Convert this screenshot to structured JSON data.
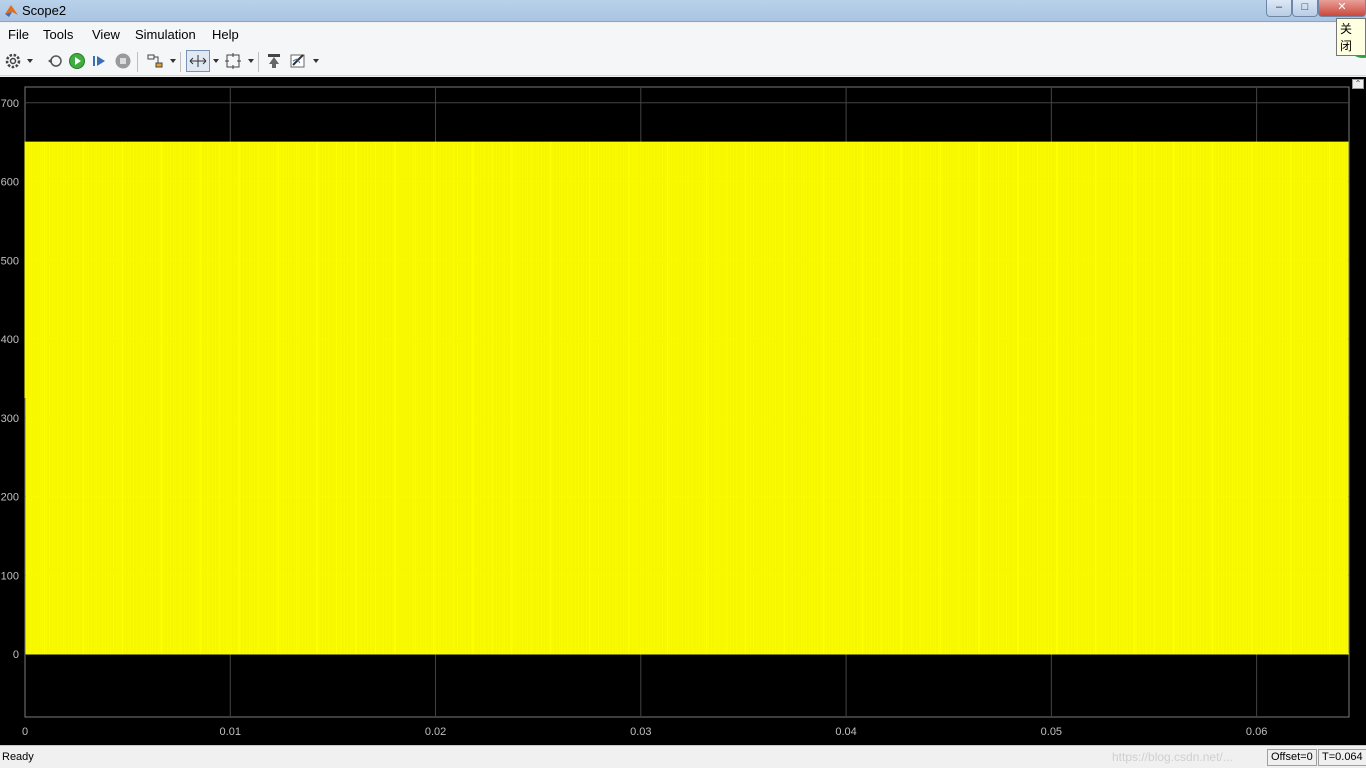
{
  "window": {
    "title": "Scope2",
    "close_tooltip": "关闭",
    "minimize": "‒",
    "maximize": "□",
    "close": "✕"
  },
  "menu": {
    "items": [
      "File",
      "Tools",
      "View",
      "Simulation",
      "Help"
    ]
  },
  "toolbar": {
    "icons": [
      "parameters-gear-icon",
      "restore-icon",
      "run-icon",
      "step-forward-icon",
      "stop-icon",
      "signal-selector-icon",
      "zoom-x-icon",
      "autoscale-icon",
      "highlight-block-icon",
      "style-icon"
    ]
  },
  "colors": {
    "plot_bg": "#000000",
    "signal": "#ffff00",
    "grid": "#444444",
    "axis_text": "#c0c0c0"
  },
  "chart_data": {
    "type": "line",
    "title": "",
    "xlabel": "",
    "ylabel": "",
    "xlim": [
      0,
      0.0645
    ],
    "ylim": [
      -80,
      720
    ],
    "xticks": [
      0,
      0.01,
      0.02,
      0.03,
      0.04,
      0.05,
      0.06
    ],
    "xtick_labels": [
      "0",
      "0.01",
      "0.02",
      "0.03",
      "0.04",
      "0.05",
      "0.06"
    ],
    "yticks": [
      0,
      100,
      200,
      300,
      400,
      500,
      600,
      700
    ],
    "ytick_labels": [
      "0",
      "100",
      "200",
      "300",
      "400",
      "500",
      "600",
      "700"
    ],
    "grid": true,
    "series": [
      {
        "waveform": "square",
        "low": 0,
        "high": 650,
        "start_value": 325,
        "period": 0.0001,
        "color": "#ffff00"
      }
    ]
  },
  "status": {
    "text": "Ready",
    "watermark": "https://blog.csdn.net/...",
    "offset": "Offset=0",
    "time": "T=0.064"
  }
}
